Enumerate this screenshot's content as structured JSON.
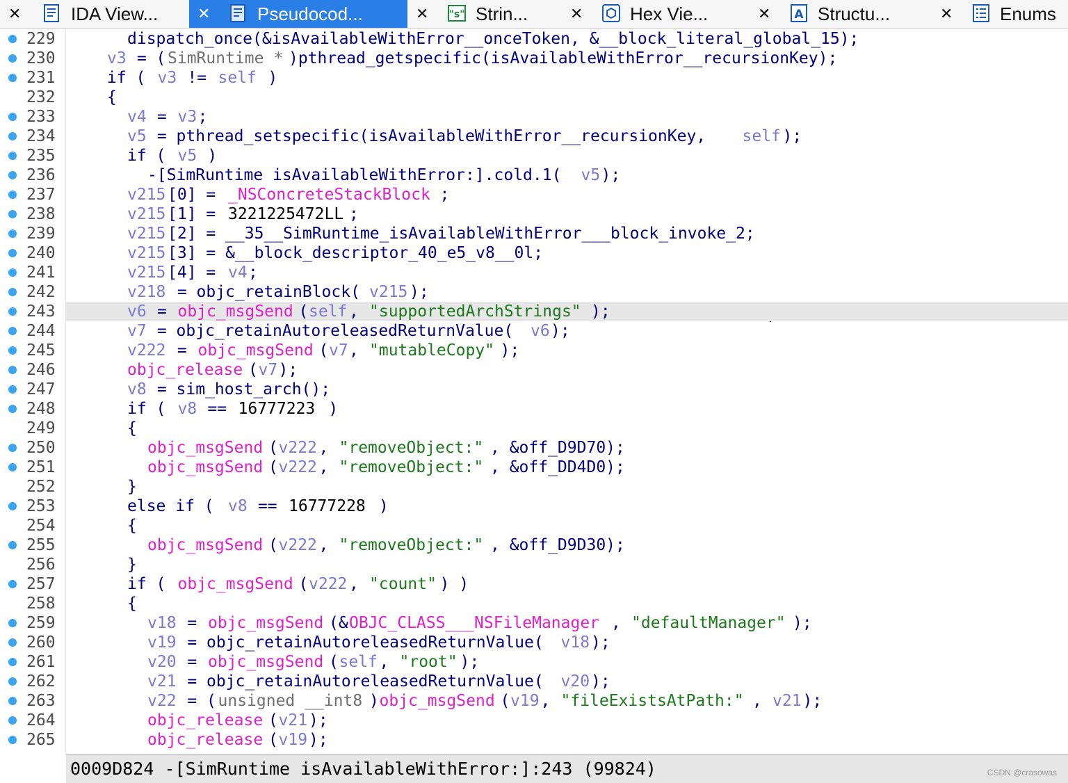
{
  "tabs": [
    {
      "title": "IDA View...",
      "icon": "ida-view-icon",
      "active": false
    },
    {
      "title": "Pseudocod...",
      "icon": "pseudocode-icon",
      "active": true
    },
    {
      "title": "Strin...",
      "icon": "strings-icon",
      "active": false
    },
    {
      "title": "Hex Vie...",
      "icon": "hex-view-icon",
      "active": false
    },
    {
      "title": "Structu...",
      "icon": "structures-icon",
      "active": false
    },
    {
      "title": "Enums",
      "icon": "enums-icon",
      "active": false
    }
  ],
  "tab_close_glyph": "✕",
  "code_lines": [
    {
      "n": "229",
      "bp": true,
      "indent": 2,
      "parts": [
        [
          "k",
          "dispatch_once(&isAvailableWithError__onceToken, &__block_literal_global_15);"
        ]
      ]
    },
    {
      "n": "230",
      "bp": true,
      "indent": 1,
      "parts": [
        [
          "v",
          "v3"
        ],
        [
          "k",
          " = ("
        ],
        [
          "t",
          "SimRuntime *"
        ],
        [
          "k",
          ")pthread_getspecific(isAvailableWithError__recursionKey);"
        ]
      ]
    },
    {
      "n": "231",
      "bp": true,
      "indent": 1,
      "parts": [
        [
          "k",
          "if ( "
        ],
        [
          "v",
          "v3"
        ],
        [
          "k",
          " != "
        ],
        [
          "v",
          "self"
        ],
        [
          "k",
          " )"
        ]
      ]
    },
    {
      "n": "232",
      "bp": false,
      "indent": 1,
      "parts": [
        [
          "k",
          "{"
        ]
      ]
    },
    {
      "n": "233",
      "bp": true,
      "indent": 2,
      "parts": [
        [
          "v",
          "v4"
        ],
        [
          "k",
          " = "
        ],
        [
          "v",
          "v3"
        ],
        [
          "k",
          ";"
        ]
      ]
    },
    {
      "n": "234",
      "bp": true,
      "indent": 2,
      "parts": [
        [
          "v",
          "v5"
        ],
        [
          "k",
          " = pthread_setspecific(isAvailableWithError__recursionKey, "
        ],
        [
          "v",
          "self"
        ],
        [
          "k",
          ");"
        ]
      ]
    },
    {
      "n": "235",
      "bp": true,
      "indent": 2,
      "parts": [
        [
          "k",
          "if ( "
        ],
        [
          "v",
          "v5"
        ],
        [
          "k",
          " )"
        ]
      ]
    },
    {
      "n": "236",
      "bp": true,
      "indent": 3,
      "parts": [
        [
          "k",
          "-[SimRuntime isAvailableWithError:].cold.1("
        ],
        [
          "v",
          "v5"
        ],
        [
          "k",
          ");"
        ]
      ]
    },
    {
      "n": "237",
      "bp": true,
      "indent": 2,
      "parts": [
        [
          "v",
          "v215"
        ],
        [
          "k",
          "[0] = "
        ],
        [
          "m",
          "_NSConcreteStackBlock"
        ],
        [
          "k",
          ";"
        ]
      ]
    },
    {
      "n": "238",
      "bp": true,
      "indent": 2,
      "parts": [
        [
          "v",
          "v215"
        ],
        [
          "k",
          "[1] = "
        ],
        [
          "n",
          "3221225472LL"
        ],
        [
          "k",
          ";"
        ]
      ]
    },
    {
      "n": "239",
      "bp": true,
      "indent": 2,
      "parts": [
        [
          "v",
          "v215"
        ],
        [
          "k",
          "[2] = __35__SimRuntime_isAvailableWithError___block_invoke_2;"
        ]
      ]
    },
    {
      "n": "240",
      "bp": true,
      "indent": 2,
      "parts": [
        [
          "v",
          "v215"
        ],
        [
          "k",
          "[3] = &__block_descriptor_40_e5_v8__0l;"
        ]
      ]
    },
    {
      "n": "241",
      "bp": true,
      "indent": 2,
      "parts": [
        [
          "v",
          "v215"
        ],
        [
          "k",
          "[4] = "
        ],
        [
          "v",
          "v4"
        ],
        [
          "k",
          ";"
        ]
      ]
    },
    {
      "n": "242",
      "bp": true,
      "indent": 2,
      "parts": [
        [
          "v",
          "v218"
        ],
        [
          "k",
          " = objc_retainBlock("
        ],
        [
          "v",
          "v215"
        ],
        [
          "k",
          ");"
        ]
      ]
    },
    {
      "n": "243",
      "bp": true,
      "indent": 2,
      "hl": true,
      "parts": [
        [
          "v",
          "v6"
        ],
        [
          "k",
          " = "
        ],
        [
          "m",
          "objc_msgSend"
        ],
        [
          "k",
          "("
        ],
        [
          "v",
          "self"
        ],
        [
          "k",
          ", "
        ],
        [
          "s",
          "\"supportedArchStrings\""
        ],
        [
          "k",
          ");"
        ]
      ]
    },
    {
      "n": "244",
      "bp": true,
      "indent": 2,
      "parts": [
        [
          "v",
          "v7"
        ],
        [
          "k",
          " = objc_retainAutoreleasedReturnValue("
        ],
        [
          "v",
          "v6"
        ],
        [
          "k",
          ");"
        ]
      ]
    },
    {
      "n": "245",
      "bp": true,
      "indent": 2,
      "parts": [
        [
          "v",
          "v222"
        ],
        [
          "k",
          " = "
        ],
        [
          "m",
          "objc_msgSend"
        ],
        [
          "k",
          "("
        ],
        [
          "v",
          "v7"
        ],
        [
          "k",
          ", "
        ],
        [
          "s",
          "\"mutableCopy\""
        ],
        [
          "k",
          ");"
        ]
      ]
    },
    {
      "n": "246",
      "bp": true,
      "indent": 2,
      "parts": [
        [
          "m",
          "objc_release"
        ],
        [
          "k",
          "("
        ],
        [
          "v",
          "v7"
        ],
        [
          "k",
          ");"
        ]
      ]
    },
    {
      "n": "247",
      "bp": true,
      "indent": 2,
      "parts": [
        [
          "v",
          "v8"
        ],
        [
          "k",
          " = sim_host_arch();"
        ]
      ]
    },
    {
      "n": "248",
      "bp": true,
      "indent": 2,
      "parts": [
        [
          "k",
          "if ( "
        ],
        [
          "v",
          "v8"
        ],
        [
          "k",
          " == "
        ],
        [
          "n",
          "16777223"
        ],
        [
          "k",
          " )"
        ]
      ]
    },
    {
      "n": "249",
      "bp": false,
      "indent": 2,
      "parts": [
        [
          "k",
          "{"
        ]
      ]
    },
    {
      "n": "250",
      "bp": true,
      "indent": 3,
      "parts": [
        [
          "m",
          "objc_msgSend"
        ],
        [
          "k",
          "("
        ],
        [
          "v",
          "v222"
        ],
        [
          "k",
          ", "
        ],
        [
          "s",
          "\"removeObject:\""
        ],
        [
          "k",
          ", &off_D9D70);"
        ]
      ]
    },
    {
      "n": "251",
      "bp": true,
      "indent": 3,
      "parts": [
        [
          "m",
          "objc_msgSend"
        ],
        [
          "k",
          "("
        ],
        [
          "v",
          "v222"
        ],
        [
          "k",
          ", "
        ],
        [
          "s",
          "\"removeObject:\""
        ],
        [
          "k",
          ", &off_DD4D0);"
        ]
      ]
    },
    {
      "n": "252",
      "bp": false,
      "indent": 2,
      "parts": [
        [
          "k",
          "}"
        ]
      ]
    },
    {
      "n": "253",
      "bp": true,
      "indent": 2,
      "parts": [
        [
          "k",
          "else if ( "
        ],
        [
          "v",
          "v8"
        ],
        [
          "k",
          " == "
        ],
        [
          "n",
          "16777228"
        ],
        [
          "k",
          " )"
        ]
      ]
    },
    {
      "n": "254",
      "bp": false,
      "indent": 2,
      "parts": [
        [
          "k",
          "{"
        ]
      ]
    },
    {
      "n": "255",
      "bp": true,
      "indent": 3,
      "parts": [
        [
          "m",
          "objc_msgSend"
        ],
        [
          "k",
          "("
        ],
        [
          "v",
          "v222"
        ],
        [
          "k",
          ", "
        ],
        [
          "s",
          "\"removeObject:\""
        ],
        [
          "k",
          ", &off_D9D30);"
        ]
      ]
    },
    {
      "n": "256",
      "bp": false,
      "indent": 2,
      "parts": [
        [
          "k",
          "}"
        ]
      ]
    },
    {
      "n": "257",
      "bp": true,
      "indent": 2,
      "parts": [
        [
          "k",
          "if ( "
        ],
        [
          "m",
          "objc_msgSend"
        ],
        [
          "k",
          "("
        ],
        [
          "v",
          "v222"
        ],
        [
          "k",
          ", "
        ],
        [
          "s",
          "\"count\""
        ],
        [
          "k",
          ") )"
        ]
      ]
    },
    {
      "n": "258",
      "bp": false,
      "indent": 2,
      "parts": [
        [
          "k",
          "{"
        ]
      ]
    },
    {
      "n": "259",
      "bp": true,
      "indent": 3,
      "parts": [
        [
          "v",
          "v18"
        ],
        [
          "k",
          " = "
        ],
        [
          "m",
          "objc_msgSend"
        ],
        [
          "k",
          "(&"
        ],
        [
          "m",
          "OBJC_CLASS___NSFileManager"
        ],
        [
          "k",
          ", "
        ],
        [
          "s",
          "\"defaultManager\""
        ],
        [
          "k",
          ");"
        ]
      ]
    },
    {
      "n": "260",
      "bp": true,
      "indent": 3,
      "parts": [
        [
          "v",
          "v19"
        ],
        [
          "k",
          " = objc_retainAutoreleasedReturnValue("
        ],
        [
          "v",
          "v18"
        ],
        [
          "k",
          ");"
        ]
      ]
    },
    {
      "n": "261",
      "bp": true,
      "indent": 3,
      "parts": [
        [
          "v",
          "v20"
        ],
        [
          "k",
          " = "
        ],
        [
          "m",
          "objc_msgSend"
        ],
        [
          "k",
          "("
        ],
        [
          "v",
          "self"
        ],
        [
          "k",
          ", "
        ],
        [
          "s",
          "\"root\""
        ],
        [
          "k",
          ");"
        ]
      ]
    },
    {
      "n": "262",
      "bp": true,
      "indent": 3,
      "parts": [
        [
          "v",
          "v21"
        ],
        [
          "k",
          " = objc_retainAutoreleasedReturnValue("
        ],
        [
          "v",
          "v20"
        ],
        [
          "k",
          ");"
        ]
      ]
    },
    {
      "n": "263",
      "bp": true,
      "indent": 3,
      "parts": [
        [
          "v",
          "v22"
        ],
        [
          "k",
          " = ("
        ],
        [
          "t",
          "unsigned __int8"
        ],
        [
          "k",
          ")"
        ],
        [
          "m",
          "objc_msgSend"
        ],
        [
          "k",
          "("
        ],
        [
          "v",
          "v19"
        ],
        [
          "k",
          ", "
        ],
        [
          "s",
          "\"fileExistsAtPath:\""
        ],
        [
          "k",
          ", "
        ],
        [
          "v",
          "v21"
        ],
        [
          "k",
          ");"
        ]
      ]
    },
    {
      "n": "264",
      "bp": true,
      "indent": 3,
      "parts": [
        [
          "m",
          "objc_release"
        ],
        [
          "k",
          "("
        ],
        [
          "v",
          "v21"
        ],
        [
          "k",
          ");"
        ]
      ]
    },
    {
      "n": "265",
      "bp": true,
      "indent": 3,
      "parts": [
        [
          "m",
          "objc_release"
        ],
        [
          "k",
          "("
        ],
        [
          "v",
          "v19"
        ],
        [
          "k",
          ");"
        ]
      ]
    }
  ],
  "status": {
    "text": "0009D824 -[SimRuntime isAvailableWithError:]:243 (99824)"
  },
  "watermark": "CSDN @crasowas",
  "colors": {
    "active_tab": "#2a7fe6",
    "breakpoint": "#3aa5f0",
    "string": "#1c7a1c",
    "variable": "#7a7ad0",
    "import": "#e020c8",
    "code": "#000080",
    "line_highlight": "#e7e7e7"
  }
}
